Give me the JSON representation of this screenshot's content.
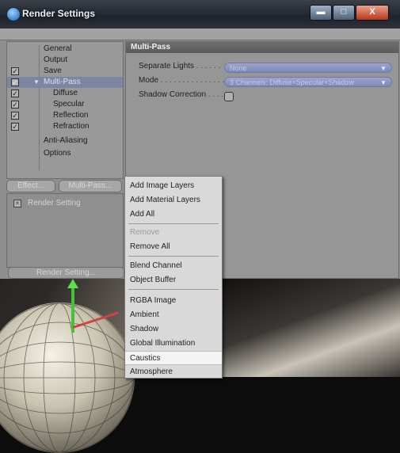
{
  "window": {
    "title": "Render Settings",
    "buttons": {
      "minimize": "▬",
      "maximize": "□",
      "close": "X"
    }
  },
  "tree": {
    "items": [
      {
        "label": "General",
        "checked": false
      },
      {
        "label": "Output",
        "checked": false
      },
      {
        "label": "Save",
        "checked": true
      },
      {
        "label": "Multi-Pass",
        "checked": true,
        "expanded": true,
        "selected": true
      },
      {
        "label": "Diffuse",
        "checked": true
      },
      {
        "label": "Specular",
        "checked": true
      },
      {
        "label": "Reflection",
        "checked": true
      },
      {
        "label": "Refraction",
        "checked": true
      },
      {
        "label": "Anti-Aliasing",
        "checked": false
      },
      {
        "label": "Options",
        "checked": false
      }
    ]
  },
  "tabs": {
    "effect": "Effect...",
    "multipass": "Multi-Pass..."
  },
  "list": {
    "item": "Render Setting"
  },
  "bottom_button": "Render Setting...",
  "panel": {
    "header": "Multi-Pass",
    "separate_lights_label": "Separate Lights",
    "separate_lights_value": "None",
    "mode_label": "Mode",
    "mode_value": "3 Channels: Diffuse+Specular+Shadow",
    "shadow_correction_label": "Shadow Correction"
  },
  "context_menu": {
    "items": [
      {
        "label": "Add Image Layers",
        "enabled": true
      },
      {
        "label": "Add Material Layers",
        "enabled": true
      },
      {
        "label": "Add All",
        "enabled": true
      },
      {
        "label": "Remove",
        "enabled": false
      },
      {
        "label": "Remove All",
        "enabled": true
      },
      {
        "label": "Blend Channel",
        "enabled": true
      },
      {
        "label": "Object Buffer",
        "enabled": true
      },
      {
        "label": "RGBA Image",
        "enabled": true
      },
      {
        "label": "Ambient",
        "enabled": true
      },
      {
        "label": "Shadow",
        "enabled": true
      },
      {
        "label": "Global Illumination",
        "enabled": true
      },
      {
        "label": "Caustics",
        "enabled": true,
        "highlighted": true
      },
      {
        "label": "Atmosphere",
        "enabled": true
      }
    ]
  },
  "colors": {
    "selection": "#7c86a0",
    "dropdown": "#8d96c4",
    "axis_y": "#46c23a"
  }
}
